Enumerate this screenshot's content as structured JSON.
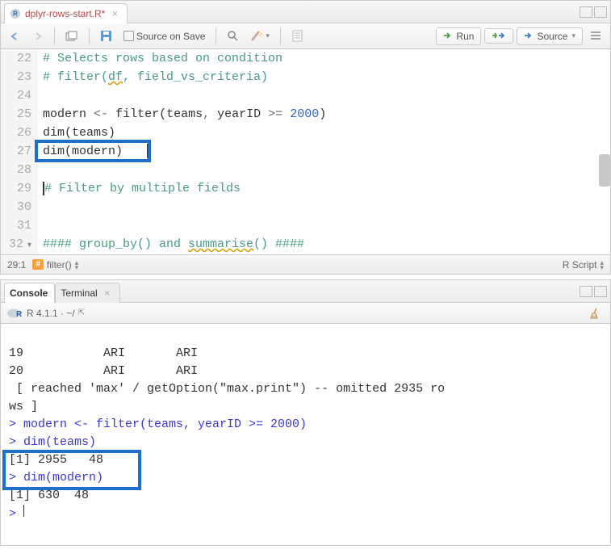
{
  "editor": {
    "tab": {
      "filename": "dplyr-rows-start.R*",
      "dirty": true
    },
    "toolbar": {
      "source_on_save": "Source on Save",
      "run": "Run",
      "rerun": "",
      "source": "Source"
    },
    "lines": [
      {
        "n": 22,
        "type": "comment",
        "text": "# Selects rows based on condition"
      },
      {
        "n": 23,
        "type": "comment_wavy",
        "text": "# filter(df, field_vs_criteria)"
      },
      {
        "n": 24,
        "type": "blank",
        "text": ""
      },
      {
        "n": 25,
        "type": "code_assign",
        "text": "modern <- filter(teams, yearID >= 2000)"
      },
      {
        "n": 26,
        "type": "code_call",
        "text": "dim(teams)"
      },
      {
        "n": 27,
        "type": "code_call_hl",
        "text": "dim(modern)"
      },
      {
        "n": 28,
        "type": "blank",
        "text": ""
      },
      {
        "n": 29,
        "type": "comment_cursor",
        "text": "# Filter by multiple fields"
      },
      {
        "n": 30,
        "type": "blank",
        "text": ""
      },
      {
        "n": 31,
        "type": "blank",
        "text": ""
      },
      {
        "n": 32,
        "type": "section",
        "text": "#### group_by() and summarise() ####"
      }
    ],
    "status": {
      "position": "29:1",
      "crumb": "filter()",
      "language": "R Script"
    }
  },
  "console": {
    "tabs": {
      "console": "Console",
      "terminal": "Terminal"
    },
    "prompt_info": "R 4.1.1 · ~/",
    "output": [
      {
        "cls": "out",
        "text": "19           ARI       ARI"
      },
      {
        "cls": "out",
        "text": "20           ARI       ARI"
      },
      {
        "cls": "out",
        "text": " [ reached 'max' / getOption(\"max.print\") -- omitted 2935 ro"
      },
      {
        "cls": "out",
        "text": "ws ]"
      },
      {
        "cls": "cmd",
        "text": "> modern <- filter(teams, yearID >= 2000)"
      },
      {
        "cls": "cmd",
        "text": "> dim(teams)"
      },
      {
        "cls": "out",
        "text": "[1] 2955   48"
      },
      {
        "cls": "cmd",
        "text": "> dim(modern)"
      },
      {
        "cls": "out",
        "text": "[1] 630  48"
      },
      {
        "cls": "cmd",
        "text": "> "
      }
    ]
  }
}
